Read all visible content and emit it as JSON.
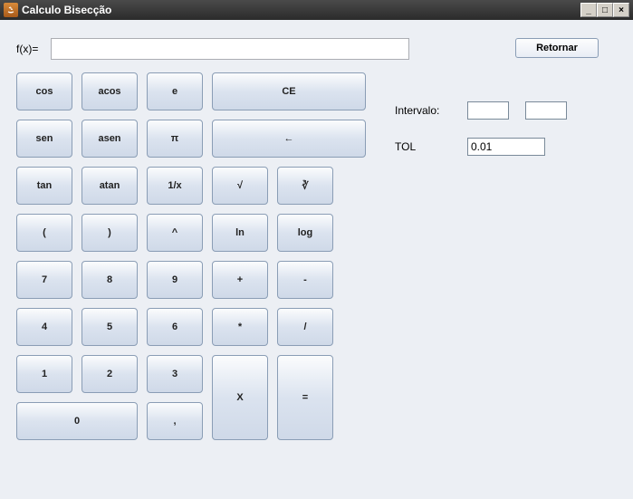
{
  "window": {
    "title": "Calculo Bisecção"
  },
  "fx": {
    "label": "f(x)=",
    "value": ""
  },
  "actions": {
    "retornar": "Retornar"
  },
  "side": {
    "interval_label": "Intervalo:",
    "interval_a": "",
    "interval_b": "",
    "tol_label": "TOL",
    "tol_value": "0.01"
  },
  "keys": {
    "cos": "cos",
    "acos": "acos",
    "e": "e",
    "ce": "CE",
    "sen": "sen",
    "asen": "asen",
    "pi": "π",
    "back": "←",
    "tan": "tan",
    "atan": "atan",
    "inv": "1/x",
    "sqrt": "√",
    "cbrt": "∛",
    "lpar": "(",
    "rpar": ")",
    "pow": "^",
    "ln": "ln",
    "log": "log",
    "n7": "7",
    "n8": "8",
    "n9": "9",
    "plus": "+",
    "minus": "-",
    "n4": "4",
    "n5": "5",
    "n6": "6",
    "mul": "*",
    "div": "/",
    "n1": "1",
    "n2": "2",
    "n3": "3",
    "n0": "0",
    "comma": ",",
    "x": "X",
    "eq": "="
  }
}
